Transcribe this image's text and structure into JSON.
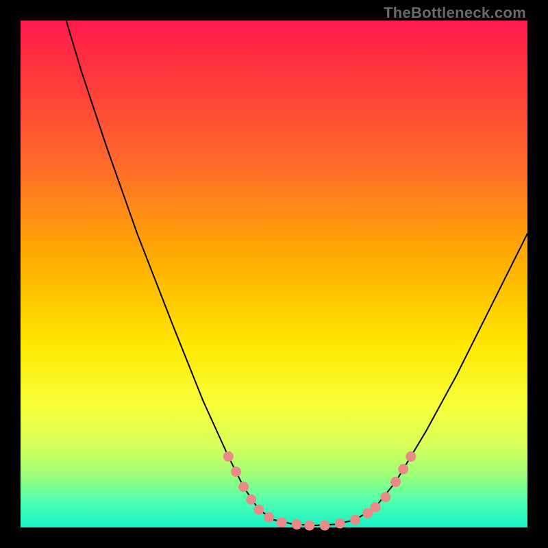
{
  "attribution": "TheBottleneck.com",
  "chart_data": {
    "type": "line",
    "title": "",
    "xlabel": "",
    "ylabel": "",
    "xlim": [
      0,
      100
    ],
    "ylim": [
      0,
      100
    ],
    "grid": false,
    "legend": false,
    "background": {
      "kind": "vertical-gradient",
      "stops": [
        {
          "pos": 0,
          "color": "#ff1a4d"
        },
        {
          "pos": 12,
          "color": "#ff3a3a"
        },
        {
          "pos": 28,
          "color": "#ff6a2a"
        },
        {
          "pos": 48,
          "color": "#ffb000"
        },
        {
          "pos": 64,
          "color": "#ffe800"
        },
        {
          "pos": 76,
          "color": "#f6ff3a"
        },
        {
          "pos": 84,
          "color": "#d6ff5a"
        },
        {
          "pos": 90,
          "color": "#98ff7a"
        },
        {
          "pos": 95,
          "color": "#4dffb0"
        },
        {
          "pos": 100,
          "color": "#18f0c8"
        }
      ]
    },
    "curve": {
      "name": "bottleneck-curve",
      "color": "#000000",
      "width": 2,
      "points": [
        {
          "x": 9.0,
          "y": 100.0
        },
        {
          "x": 12.0,
          "y": 90.0
        },
        {
          "x": 17.0,
          "y": 75.0
        },
        {
          "x": 23.0,
          "y": 58.0
        },
        {
          "x": 30.0,
          "y": 40.0
        },
        {
          "x": 36.0,
          "y": 25.0
        },
        {
          "x": 41.0,
          "y": 14.0
        },
        {
          "x": 44.0,
          "y": 8.0
        },
        {
          "x": 47.0,
          "y": 3.5
        },
        {
          "x": 50.0,
          "y": 1.5
        },
        {
          "x": 54.0,
          "y": 0.6
        },
        {
          "x": 58.0,
          "y": 0.4
        },
        {
          "x": 62.0,
          "y": 0.6
        },
        {
          "x": 66.0,
          "y": 1.5
        },
        {
          "x": 70.0,
          "y": 4.0
        },
        {
          "x": 74.0,
          "y": 9.0
        },
        {
          "x": 80.0,
          "y": 19.0
        },
        {
          "x": 86.0,
          "y": 30.0
        },
        {
          "x": 92.0,
          "y": 42.0
        },
        {
          "x": 98.0,
          "y": 54.0
        },
        {
          "x": 100.0,
          "y": 58.0
        }
      ]
    },
    "markers": {
      "color": "#e88a87",
      "radius": 7,
      "points": [
        {
          "x": 41.0,
          "y": 14.0
        },
        {
          "x": 42.5,
          "y": 11.0
        },
        {
          "x": 44.0,
          "y": 8.0
        },
        {
          "x": 45.5,
          "y": 5.5
        },
        {
          "x": 47.0,
          "y": 3.5
        },
        {
          "x": 49.0,
          "y": 2.0
        },
        {
          "x": 51.5,
          "y": 1.0
        },
        {
          "x": 54.5,
          "y": 0.6
        },
        {
          "x": 57.0,
          "y": 0.4
        },
        {
          "x": 60.0,
          "y": 0.4
        },
        {
          "x": 63.0,
          "y": 0.8
        },
        {
          "x": 66.0,
          "y": 1.5
        },
        {
          "x": 68.5,
          "y": 2.8
        },
        {
          "x": 70.0,
          "y": 4.0
        },
        {
          "x": 72.0,
          "y": 6.0
        },
        {
          "x": 74.0,
          "y": 9.0
        },
        {
          "x": 75.5,
          "y": 11.5
        },
        {
          "x": 77.0,
          "y": 14.0
        }
      ]
    }
  }
}
